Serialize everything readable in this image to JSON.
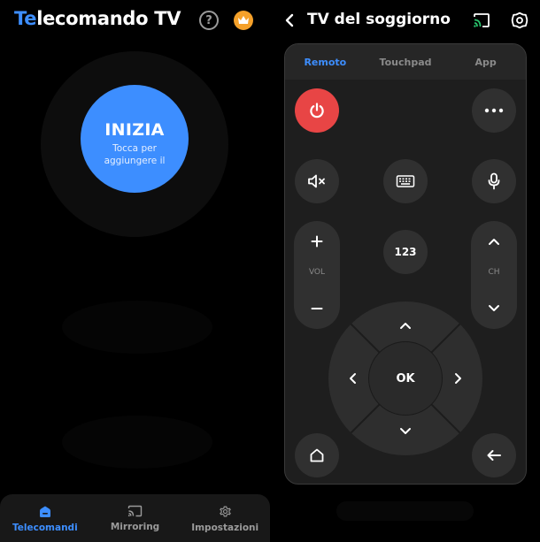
{
  "left_screen": {
    "brand": {
      "accent_part": "Te",
      "rest": "lecomando TV"
    },
    "header_icons": {
      "help": "?",
      "help_icon": "question-circle-icon",
      "premium_icon": "crown-icon"
    },
    "start_button": {
      "title": "INIZIA",
      "subtitle": "Tocca per aggiungere il"
    },
    "bottom_nav": [
      {
        "label": "Telecomandi",
        "icon": "remote-home-icon",
        "active": true
      },
      {
        "label": "Mirroring",
        "icon": "cast-icon",
        "active": false
      },
      {
        "label": "Impostazioni",
        "icon": "gear-icon",
        "active": false
      }
    ]
  },
  "right_screen": {
    "title": "TV del soggiorno",
    "header_icons": {
      "back": "chevron-left-icon",
      "cast": "cast-icon",
      "settings": "gear-icon"
    },
    "tabs": [
      {
        "label": "Remoto",
        "active": true
      },
      {
        "label": "Touchpad",
        "active": false
      },
      {
        "label": "App",
        "active": false
      }
    ],
    "remote": {
      "num_label": "123",
      "vol_label": "VOL",
      "ch_label": "CH",
      "ok_label": "OK"
    }
  },
  "colors": {
    "accent": "#3d8eff",
    "power": "#e84545",
    "premium": "#f5a12a",
    "button_bg": "#303030",
    "panel_bg": "#1e1e1e"
  }
}
